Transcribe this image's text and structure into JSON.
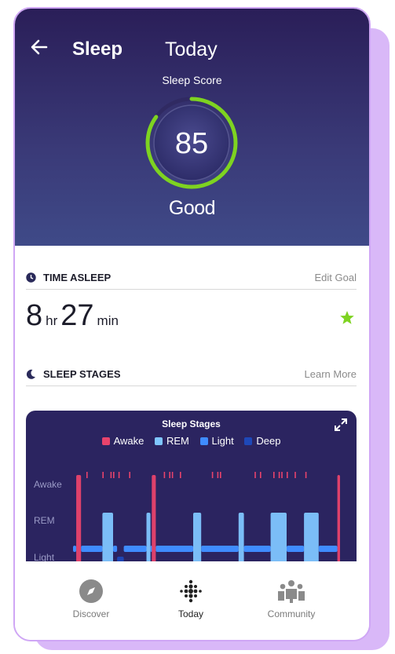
{
  "header": {
    "title": "Sleep",
    "day": "Today",
    "score_label": "Sleep Score",
    "score": 85,
    "score_fraction": 0.85,
    "quality": "Good"
  },
  "time_asleep": {
    "section_title": "TIME ASLEEP",
    "link": "Edit Goal",
    "hours": "8",
    "hours_unit": "hr",
    "minutes": "27",
    "minutes_unit": "min",
    "goal_icon": "star-icon"
  },
  "sleep_stages": {
    "section_title": "SLEEP STAGES",
    "link": "Learn More",
    "chart_title": "Sleep Stages",
    "legend": [
      {
        "label": "Awake",
        "color": "#e8436c"
      },
      {
        "label": "REM",
        "color": "#7fc6ff"
      },
      {
        "label": "Light",
        "color": "#3f8cff"
      },
      {
        "label": "Deep",
        "color": "#1e48b8"
      }
    ],
    "y_labels": [
      "Awake",
      "REM",
      "Light"
    ]
  },
  "chart_data": {
    "type": "area",
    "title": "Sleep Stages",
    "categories": [
      "Awake",
      "REM",
      "Light",
      "Deep"
    ],
    "segments": [
      [
        "Light",
        0.0,
        0.012
      ],
      [
        "Awake",
        0.012,
        0.03
      ],
      [
        "Light",
        0.03,
        0.11
      ],
      [
        "REM",
        0.11,
        0.15
      ],
      [
        "Light",
        0.15,
        0.165
      ],
      [
        "Deep",
        0.165,
        0.19
      ],
      [
        "Light",
        0.19,
        0.275
      ],
      [
        "REM",
        0.275,
        0.29
      ],
      [
        "Light",
        0.29,
        0.295
      ],
      [
        "Awake",
        0.295,
        0.31
      ],
      [
        "Light",
        0.31,
        0.45
      ],
      [
        "REM",
        0.45,
        0.48
      ],
      [
        "Light",
        0.48,
        0.62
      ],
      [
        "REM",
        0.62,
        0.64
      ],
      [
        "Light",
        0.64,
        0.74
      ],
      [
        "REM",
        0.74,
        0.8
      ],
      [
        "Light",
        0.8,
        0.865
      ],
      [
        "REM",
        0.865,
        0.92
      ],
      [
        "Light",
        0.92,
        0.99
      ],
      [
        "Awake",
        0.99,
        1.0
      ]
    ],
    "awake_ticks": [
      0.05,
      0.11,
      0.14,
      0.15,
      0.17,
      0.21,
      0.34,
      0.36,
      0.37,
      0.4,
      0.52,
      0.54,
      0.55,
      0.68,
      0.7,
      0.75,
      0.77,
      0.78,
      0.8,
      0.83,
      0.87
    ]
  },
  "nav": {
    "items": [
      {
        "label": "Discover",
        "icon": "compass-icon"
      },
      {
        "label": "Today",
        "icon": "fitbit-dots-icon"
      },
      {
        "label": "Community",
        "icon": "people-icon"
      }
    ]
  }
}
